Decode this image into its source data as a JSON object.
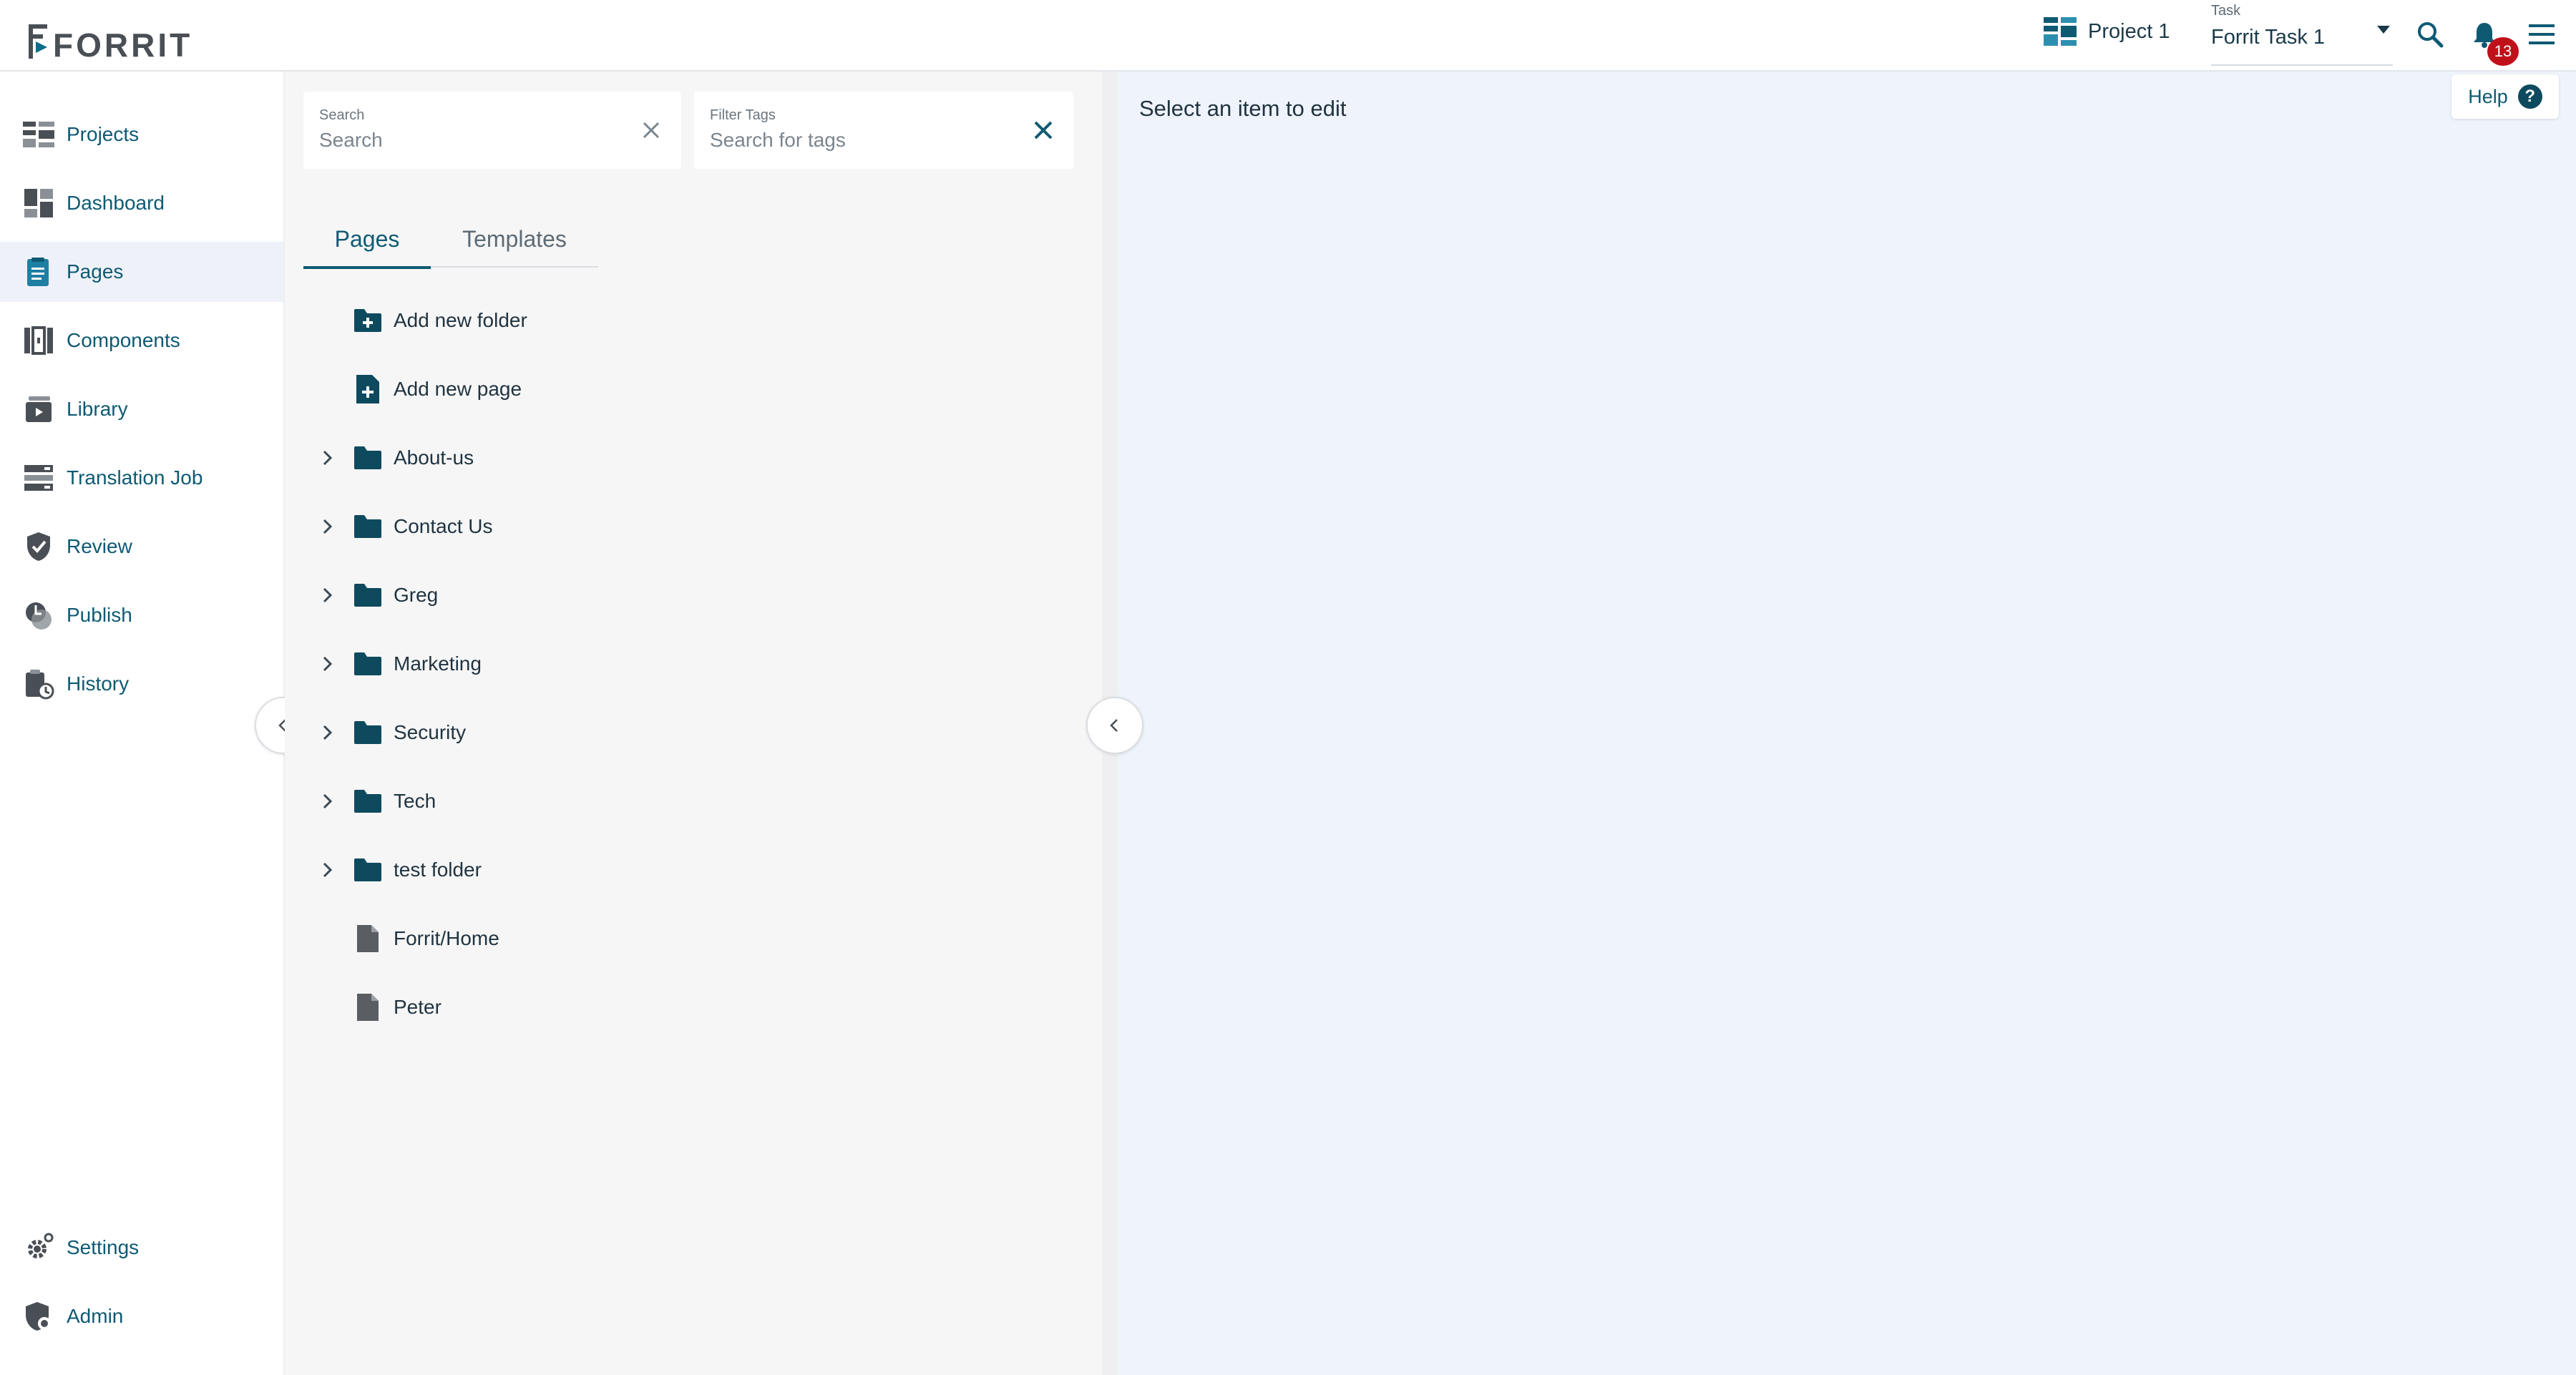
{
  "header": {
    "logo_text": "FORRIT",
    "project_label": "Project 1",
    "task_caption": "Task",
    "task_value": "Forrit Task 1",
    "notification_count": "13"
  },
  "sidebar": {
    "items": [
      {
        "label": "Projects",
        "icon": "projects-icon"
      },
      {
        "label": "Dashboard",
        "icon": "dashboard-icon"
      },
      {
        "label": "Pages",
        "icon": "pages-icon",
        "active": true
      },
      {
        "label": "Components",
        "icon": "components-icon"
      },
      {
        "label": "Library",
        "icon": "library-icon"
      },
      {
        "label": "Translation Job",
        "icon": "translation-job-icon"
      },
      {
        "label": "Review",
        "icon": "review-icon"
      },
      {
        "label": "Publish",
        "icon": "publish-icon"
      },
      {
        "label": "History",
        "icon": "history-icon"
      }
    ],
    "bottom_items": [
      {
        "label": "Settings",
        "icon": "gear-icon"
      },
      {
        "label": "Admin",
        "icon": "admin-shield-icon"
      }
    ]
  },
  "search": {
    "caption": "Search",
    "placeholder": "Search"
  },
  "filter_tags": {
    "caption": "Filter Tags",
    "placeholder": "Search for tags"
  },
  "tabs": [
    {
      "label": "Pages",
      "active": true
    },
    {
      "label": "Templates",
      "active": false
    }
  ],
  "tree": {
    "actions": [
      {
        "label": "Add new folder",
        "icon": "add-folder-icon"
      },
      {
        "label": "Add new page",
        "icon": "add-page-icon"
      }
    ],
    "folders": [
      {
        "label": "About-us"
      },
      {
        "label": "Contact Us"
      },
      {
        "label": "Greg"
      },
      {
        "label": "Marketing"
      },
      {
        "label": "Security"
      },
      {
        "label": "Tech"
      },
      {
        "label": "test folder"
      }
    ],
    "pages": [
      {
        "label": "Forrit/Home"
      },
      {
        "label": "Peter"
      }
    ]
  },
  "editor": {
    "empty_message": "Select an item to edit"
  },
  "help": {
    "label": "Help",
    "glyph": "?"
  },
  "colors": {
    "accent": "#0e5a73",
    "folder": "#0e4a5e",
    "badge": "#c0101a",
    "editor_bg": "#eff3fb",
    "panel_bg": "#f6f6f6"
  }
}
